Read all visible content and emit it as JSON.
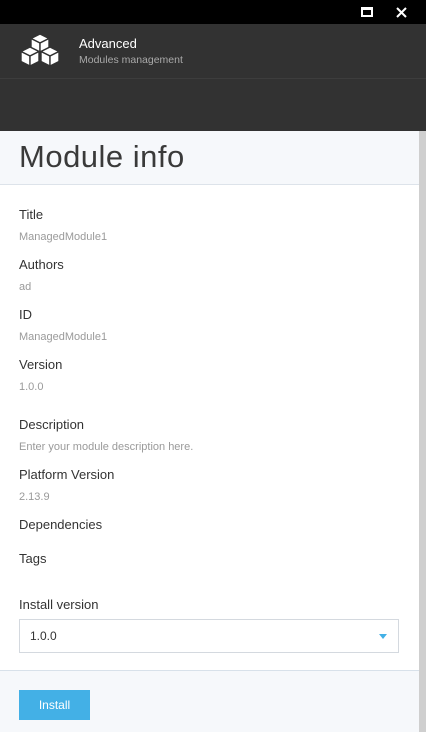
{
  "window": {
    "maximize_icon": "maximize-icon",
    "close_icon": "close-icon"
  },
  "blade": {
    "logo_icon": "cubes-logo-icon",
    "title": "Advanced",
    "subtitle": "Modules management"
  },
  "module_info": {
    "heading": "Module info",
    "fields": [
      {
        "label": "Title",
        "value": "ManagedModule1"
      },
      {
        "label": "Authors",
        "value": "ad"
      },
      {
        "label": "ID",
        "value": "ManagedModule1"
      },
      {
        "label": "Version",
        "value": "1.0.0"
      },
      {
        "label": "Description",
        "value": "Enter your module description here."
      },
      {
        "label": "Platform Version",
        "value": "2.13.9"
      },
      {
        "label": "Dependencies",
        "value": ""
      },
      {
        "label": "Tags",
        "value": ""
      }
    ],
    "install_version": {
      "label": "Install version",
      "selected": "1.0.0"
    }
  },
  "footer": {
    "install_label": "Install"
  },
  "colors": {
    "accent": "#43b0e6",
    "header_bg": "#323232",
    "titlebar_bg": "#000000"
  }
}
